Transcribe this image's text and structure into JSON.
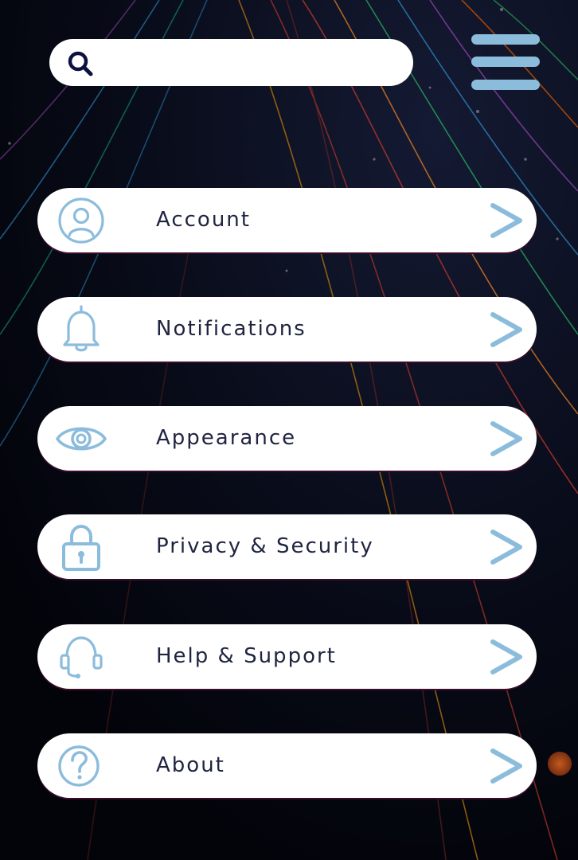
{
  "search": {
    "placeholder": "",
    "value": "",
    "icon": "search-icon"
  },
  "header": {
    "menu_icon": "hamburger-menu-icon"
  },
  "menu": {
    "items": [
      {
        "label": "Account",
        "icon": "user-circle-icon"
      },
      {
        "label": "Notifications",
        "icon": "bell-icon"
      },
      {
        "label": "Appearance",
        "icon": "eye-icon"
      },
      {
        "label": "Privacy & Security",
        "icon": "lock-icon"
      },
      {
        "label": "Help & Support",
        "icon": "headset-icon"
      },
      {
        "label": "About",
        "icon": "question-circle-icon"
      }
    ]
  },
  "colors": {
    "background": "#05070f",
    "card": "#ffffff",
    "icon_accent": "#8cbcdc",
    "text": "#1f2440",
    "search_icon": "#0d1140"
  }
}
